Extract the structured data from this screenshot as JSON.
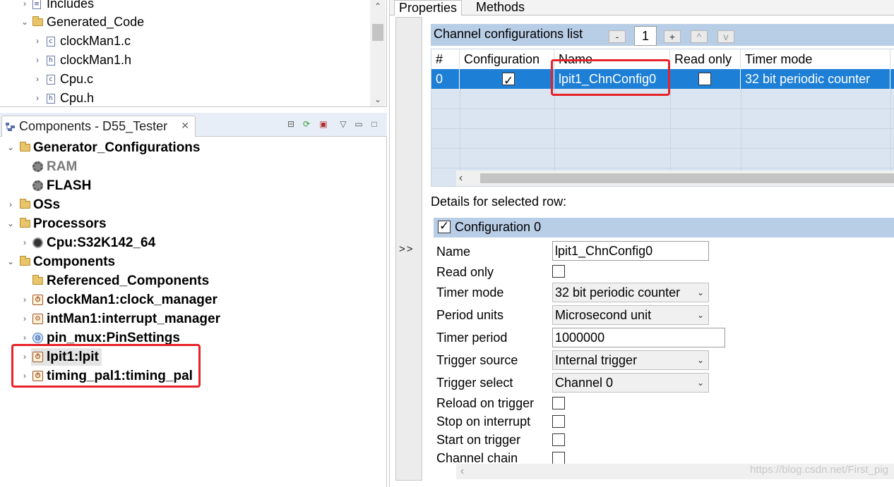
{
  "project_tree": {
    "items": [
      {
        "label": "Includes",
        "icon": "folder-icon",
        "expanded": false
      },
      {
        "label": "Generated_Code",
        "icon": "folder-icon",
        "expanded": true
      },
      {
        "label": "clockMan1.c",
        "icon": "c-file-icon"
      },
      {
        "label": "clockMan1.h",
        "icon": "h-file-icon"
      },
      {
        "label": "Cpu.c",
        "icon": "c-file-icon"
      },
      {
        "label": "Cpu.h",
        "icon": "h-file-icon"
      }
    ]
  },
  "components_view": {
    "tab_title": "Components - D55_Tester",
    "items": [
      {
        "label": "Generator_Configurations",
        "expanded": true
      },
      {
        "label": "RAM",
        "disabled": true
      },
      {
        "label": "FLASH"
      },
      {
        "label": "OSs",
        "expanded": false
      },
      {
        "label": "Processors",
        "expanded": true
      },
      {
        "label": "Cpu:S32K142_64"
      },
      {
        "label": "Components",
        "expanded": true
      },
      {
        "label": "Referenced_Components"
      },
      {
        "label": "clockMan1:clock_manager"
      },
      {
        "label": "intMan1:interrupt_manager"
      },
      {
        "label": "pin_mux:PinSettings"
      },
      {
        "label": "lpit1:lpit",
        "selected": true
      },
      {
        "label": "timing_pal1:timing_pal"
      }
    ]
  },
  "right_panel": {
    "tabs": [
      "Properties",
      "Methods"
    ],
    "collapse_label": ">>",
    "channel_list": {
      "title": "Channel configurations list",
      "count": "1",
      "buttons": {
        "remove": "-",
        "add": "+",
        "up": "^",
        "down": "v"
      },
      "columns": [
        "#",
        "Configuration",
        "Name",
        "Read only",
        "Timer mode"
      ],
      "rows": [
        {
          "index": "0",
          "configuration": true,
          "name": "lpit1_ChnConfig0",
          "read_only": false,
          "timer_mode": "32 bit periodic counter"
        }
      ]
    },
    "details": {
      "label": "Details for selected row:",
      "config_title": "Configuration 0",
      "config_enabled": true,
      "fields": {
        "name_label": "Name",
        "name_value": "lpit1_ChnConfig0",
        "read_only_label": "Read only",
        "timer_mode_label": "Timer mode",
        "timer_mode_value": "32 bit periodic counter",
        "period_units_label": "Period units",
        "period_units_value": "Microsecond unit",
        "timer_period_label": "Timer period",
        "timer_period_value": "1000000",
        "trigger_source_label": "Trigger source",
        "trigger_source_value": "Internal trigger",
        "trigger_select_label": "Trigger select",
        "trigger_select_value": "Channel 0",
        "reload_on_trigger_label": "Reload on trigger",
        "stop_on_interrupt_label": "Stop on interrupt",
        "start_on_trigger_label": "Start on trigger",
        "channel_chain_label": "Channel chain"
      }
    },
    "watermark": "https://blog.csdn.net/First_pig"
  },
  "colors": {
    "selection_blue": "#1e7fd6",
    "header_blue": "#b8cde6",
    "grid_blue": "#dbe5f1",
    "highlight_red": "#e8222a"
  }
}
